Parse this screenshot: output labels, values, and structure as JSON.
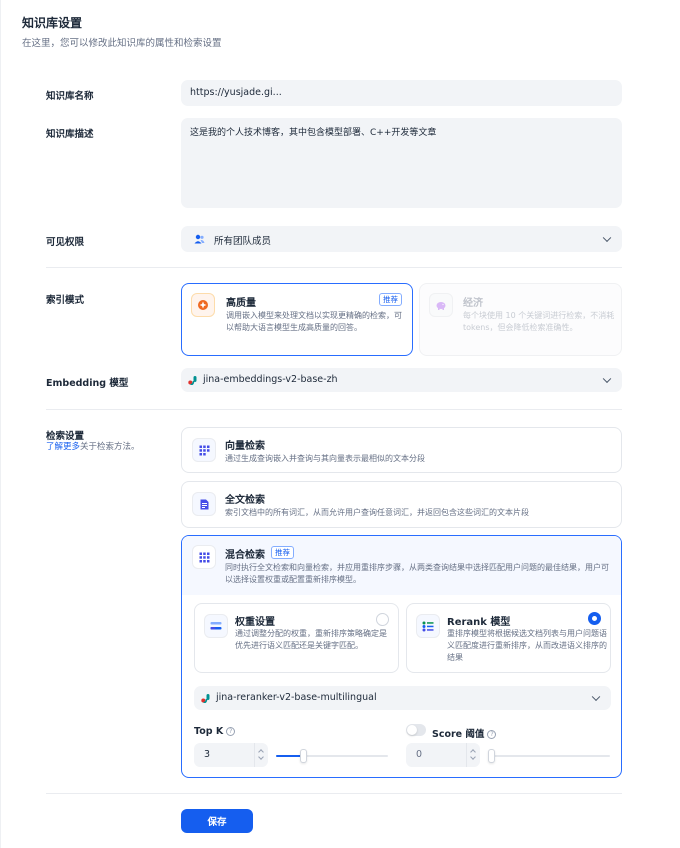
{
  "header": {
    "title": "知识库设置",
    "subtitle": "在这里，您可以修改此知识库的属性和检索设置"
  },
  "name_field": {
    "label": "知识库名称",
    "value": "https://yusjade.gi..."
  },
  "desc_field": {
    "label": "知识库描述",
    "value": "这是我的个人技术博客，其中包含模型部署、C++开发等文章"
  },
  "visibility": {
    "label": "可见权限",
    "value": "所有团队成员"
  },
  "index_mode": {
    "label": "索引模式",
    "high_quality": {
      "title": "高质量",
      "badge": "推荐",
      "desc": "调用嵌入模型来处理文档以实现更精确的检索，可以帮助大语言模型生成高质量的回答。"
    },
    "economy": {
      "title": "经济",
      "desc": "每个块使用 10 个关键词进行检索，不消耗 tokens，但会降低检索准确性。"
    }
  },
  "embedding": {
    "label": "Embedding 模型",
    "value": "jina-embeddings-v2-base-zh"
  },
  "retrieval": {
    "label": "检索设置",
    "learn_more": "了解更多",
    "learn_more_suffix": "关于检索方法。",
    "vector": {
      "title": "向量检索",
      "desc": "通过生成查询嵌入并查询与其向量表示最相似的文本分段"
    },
    "fulltext": {
      "title": "全文检索",
      "desc": "索引文档中的所有词汇，从而允许用户查询任意词汇，并返回包含这些词汇的文本片段"
    },
    "hybrid": {
      "title": "混合检索",
      "badge": "推荐",
      "desc": "同时执行全文检索和向量检索，并应用重排序步骤，从两类查询结果中选择匹配用户问题的最佳结果，用户可以选择设置权重或配置重新排序模型。",
      "weight": {
        "title": "权重设置",
        "desc": "通过调整分配的权重，重新排序策略确定是优先进行语义匹配还是关键字匹配。"
      },
      "rerank": {
        "title": "Rerank 模型",
        "desc": "重排序模型将根据候选文档列表与用户问题语义匹配度进行重新排序，从而改进语义排序的结果"
      },
      "rerank_model": "jina-reranker-v2-base-multilingual",
      "top_k": {
        "label": "Top K",
        "value": "3",
        "slider_fraction": 0.24
      },
      "score": {
        "label": "Score 阈值",
        "value": "0",
        "enabled": false,
        "slider_fraction": 0.0
      }
    }
  },
  "save_label": "保存",
  "colors": {
    "primary": "#155eef",
    "input_bg": "#f2f4f7",
    "border": "#e4e7ec"
  }
}
